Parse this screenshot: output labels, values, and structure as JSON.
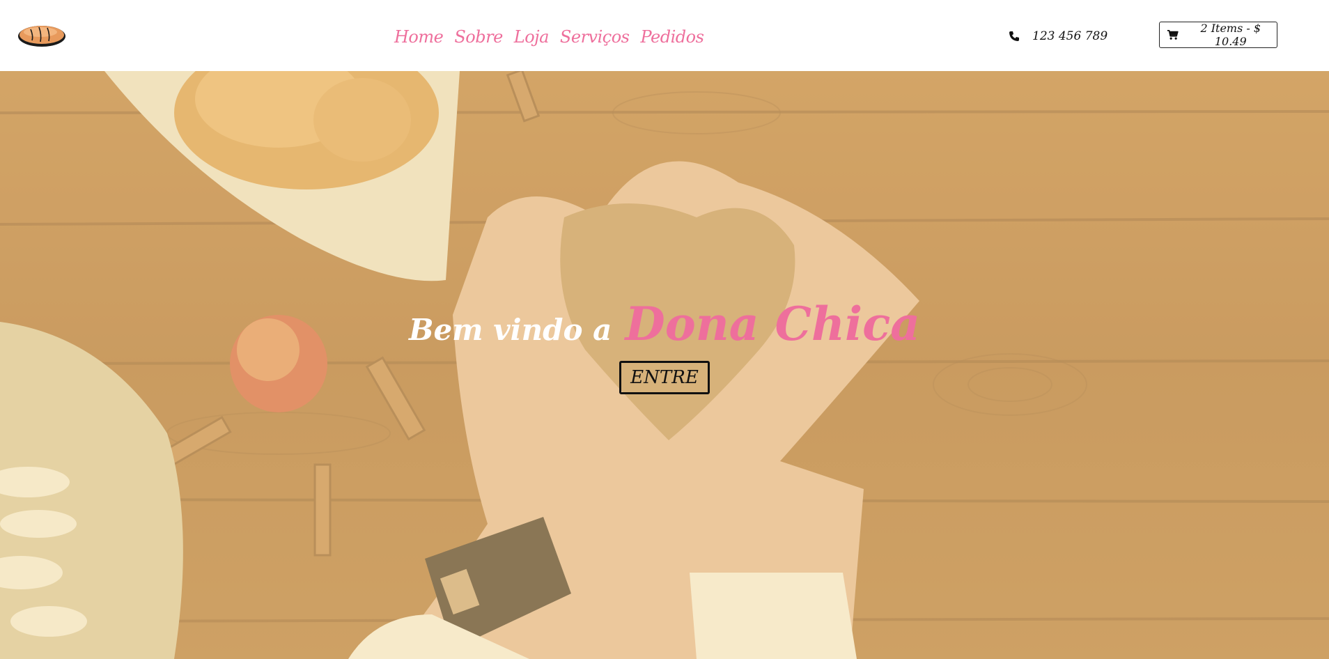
{
  "header": {
    "nav": [
      {
        "label": "Home"
      },
      {
        "label": "Sobre"
      },
      {
        "label": "Loja"
      },
      {
        "label": "Serviços"
      },
      {
        "label": "Pedidos"
      }
    ],
    "phone": "123 456 789",
    "cart_label": "2 Items - $ 10.49"
  },
  "hero": {
    "welcome": "Bem vindo a",
    "brand": "Dona Chica",
    "enter_label": "ENTRE"
  },
  "colors": {
    "accent": "#ee6f9c",
    "text": "#111111"
  },
  "icons": [
    "bread-logo",
    "phone-icon",
    "cart-icon"
  ]
}
